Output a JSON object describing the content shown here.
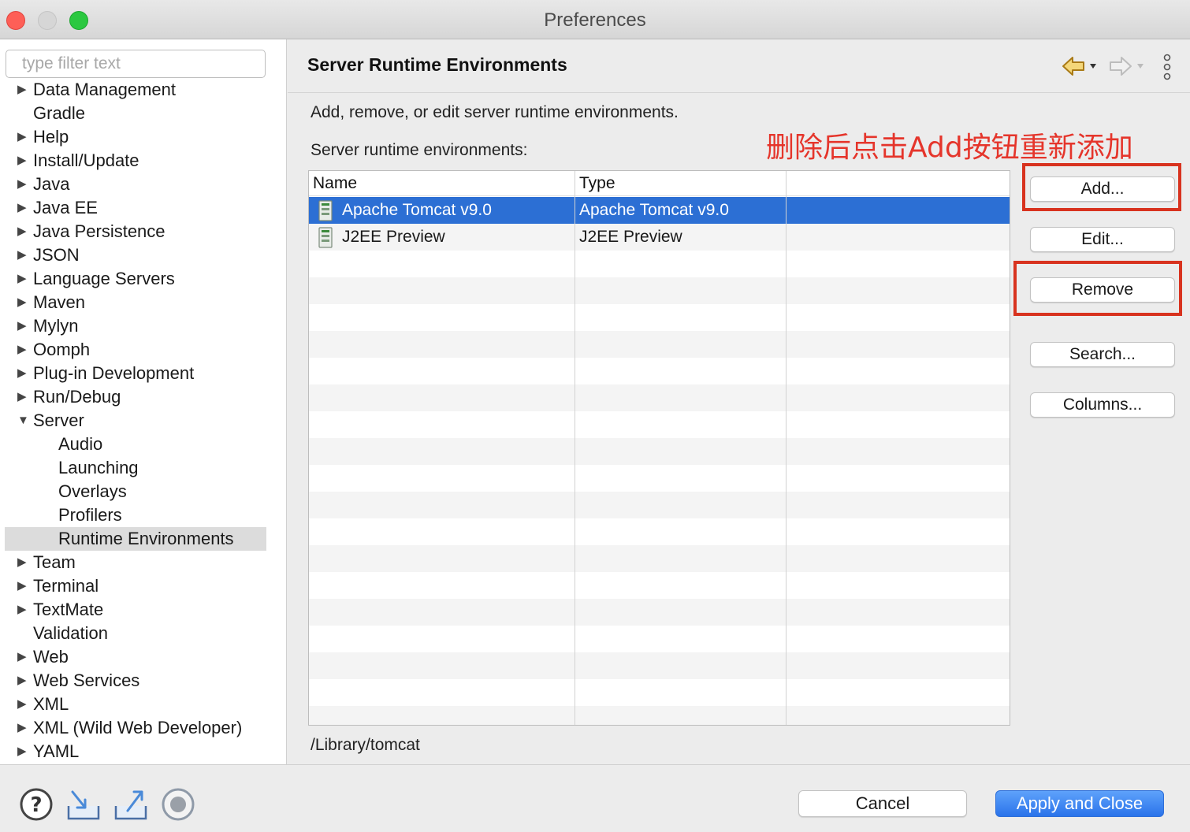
{
  "window": {
    "title": "Preferences"
  },
  "filter": {
    "placeholder": "type filter text",
    "value": ""
  },
  "tree": {
    "items": [
      {
        "label": "Data Management",
        "arrow": "▶",
        "child": false
      },
      {
        "label": "Gradle",
        "arrow": "",
        "child": false
      },
      {
        "label": "Help",
        "arrow": "▶",
        "child": false
      },
      {
        "label": "Install/Update",
        "arrow": "▶",
        "child": false
      },
      {
        "label": "Java",
        "arrow": "▶",
        "child": false
      },
      {
        "label": "Java EE",
        "arrow": "▶",
        "child": false
      },
      {
        "label": "Java Persistence",
        "arrow": "▶",
        "child": false
      },
      {
        "label": "JSON",
        "arrow": "▶",
        "child": false
      },
      {
        "label": "Language Servers",
        "arrow": "▶",
        "child": false
      },
      {
        "label": "Maven",
        "arrow": "▶",
        "child": false
      },
      {
        "label": "Mylyn",
        "arrow": "▶",
        "child": false
      },
      {
        "label": "Oomph",
        "arrow": "▶",
        "child": false
      },
      {
        "label": "Plug-in Development",
        "arrow": "▶",
        "child": false
      },
      {
        "label": "Run/Debug",
        "arrow": "▶",
        "child": false
      },
      {
        "label": "Server",
        "arrow": "▼",
        "child": false
      },
      {
        "label": "Audio",
        "arrow": "",
        "child": true
      },
      {
        "label": "Launching",
        "arrow": "",
        "child": true
      },
      {
        "label": "Overlays",
        "arrow": "",
        "child": true
      },
      {
        "label": "Profilers",
        "arrow": "",
        "child": true
      },
      {
        "label": "Runtime Environments",
        "arrow": "",
        "child": true,
        "selected": true
      },
      {
        "label": "Team",
        "arrow": "▶",
        "child": false
      },
      {
        "label": "Terminal",
        "arrow": "▶",
        "child": false
      },
      {
        "label": "TextMate",
        "arrow": "▶",
        "child": false
      },
      {
        "label": "Validation",
        "arrow": "",
        "child": false
      },
      {
        "label": "Web",
        "arrow": "▶",
        "child": false
      },
      {
        "label": "Web Services",
        "arrow": "▶",
        "child": false
      },
      {
        "label": "XML",
        "arrow": "▶",
        "child": false
      },
      {
        "label": "XML (Wild Web Developer)",
        "arrow": "▶",
        "child": false
      },
      {
        "label": "YAML",
        "arrow": "▶",
        "child": false
      }
    ]
  },
  "page": {
    "title": "Server Runtime Environments",
    "description": "Add, remove, or edit server runtime environments.",
    "table_label": "Server runtime environments:",
    "annotation": "删除后点击Add按钮重新添加",
    "path": "/Library/tomcat"
  },
  "table": {
    "columns": [
      "Name",
      "Type"
    ],
    "rows": [
      {
        "name": "Apache Tomcat v9.0",
        "type": "Apache Tomcat v9.0",
        "selected": true
      },
      {
        "name": "J2EE Preview",
        "type": "J2EE Preview",
        "selected": false
      }
    ]
  },
  "buttons": {
    "add": "Add...",
    "edit": "Edit...",
    "remove": "Remove",
    "search": "Search...",
    "columns": "Columns..."
  },
  "footer": {
    "cancel": "Cancel",
    "apply": "Apply and Close"
  },
  "colors": {
    "selection": "#2c6fd4",
    "annotation": "#e5352b",
    "highlight_box": "#d8331f",
    "primary_button": "#2a73ea"
  },
  "icons": [
    "help-icon",
    "import-icon",
    "export-icon",
    "record-icon",
    "back-arrow-icon",
    "forward-arrow-icon",
    "view-menu-icon",
    "server-icon"
  ]
}
